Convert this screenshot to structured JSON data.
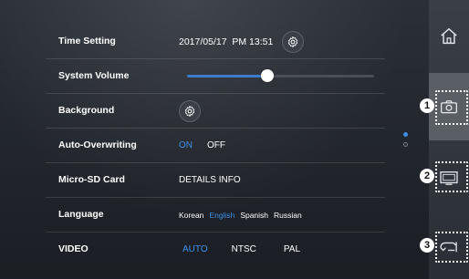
{
  "settings": {
    "time": {
      "label": "Time Setting",
      "value": "2017/05/17  PM 13:51"
    },
    "volume": {
      "label": "System Volume",
      "level": 0.43
    },
    "background": {
      "label": "Background"
    },
    "overwriting": {
      "label": "Auto-Overwriting",
      "on": "ON",
      "off": "OFF",
      "selected": "ON"
    },
    "sdcard": {
      "label": "Micro-SD Card",
      "value": "DETAILS INFO"
    },
    "language": {
      "label": "Language",
      "options": [
        "Korean",
        "English",
        "Spanish",
        "Russian"
      ],
      "selected": "English"
    },
    "video": {
      "label": "VIDEO",
      "options": [
        "AUTO",
        "NTSC",
        "PAL"
      ],
      "selected": "AUTO"
    }
  },
  "sidebar": {
    "items": [
      {
        "icon": "home-icon"
      },
      {
        "icon": "camera-icon",
        "callout": "1"
      },
      {
        "icon": "monitor-icon",
        "callout": "2"
      },
      {
        "icon": "intercom-icon",
        "callout": "3"
      }
    ]
  },
  "page_indicator": {
    "pages": 2,
    "current": 1
  },
  "colors": {
    "accent": "#3a8fe8",
    "background": "#23272e",
    "text": "#ffffff"
  }
}
